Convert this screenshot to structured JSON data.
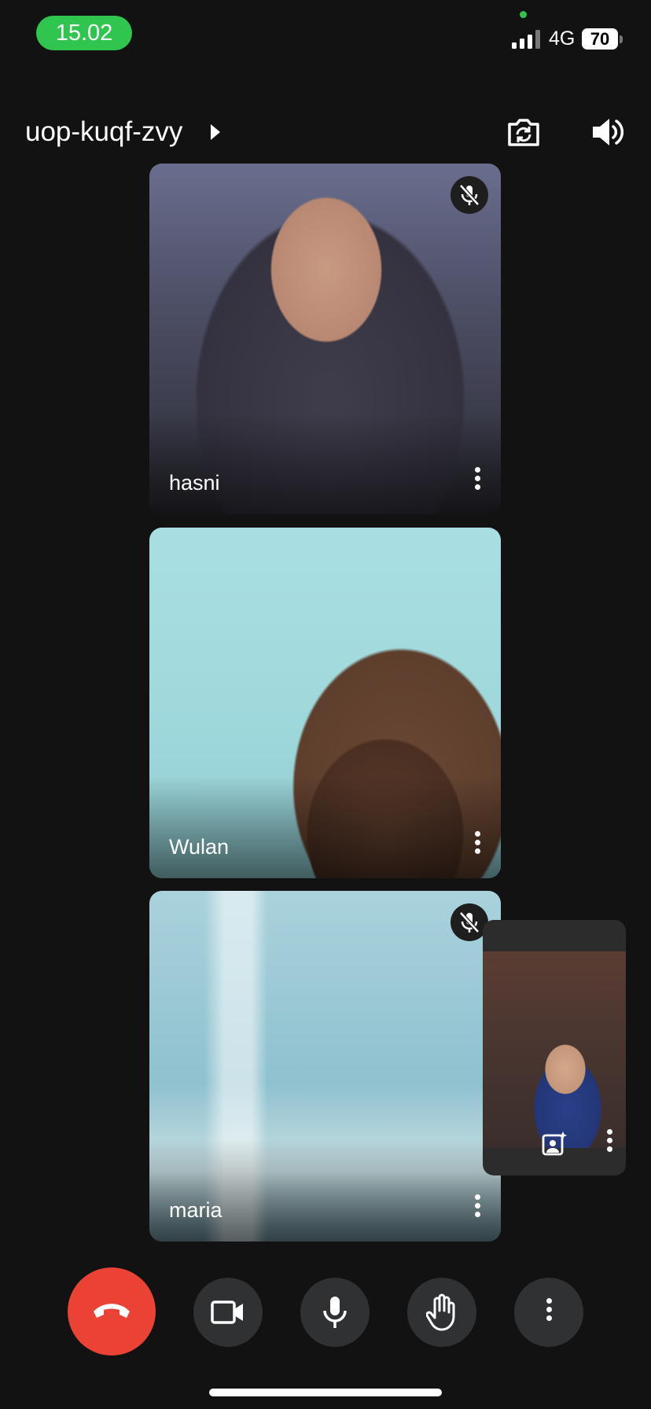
{
  "status_bar": {
    "time": "15.02",
    "network": "4G",
    "battery": "70"
  },
  "header": {
    "meeting_code": "uop-kuqf-zvy"
  },
  "participants": [
    {
      "name": "hasni",
      "muted": true
    },
    {
      "name": "Wulan",
      "muted": false
    },
    {
      "name": "maria",
      "muted": true
    }
  ],
  "controls": {
    "end_call": "end-call",
    "camera": "video-camera",
    "microphone": "microphone",
    "raise_hand": "raise-hand",
    "more": "more-options"
  },
  "colors": {
    "end_call": "#ea4335",
    "time_pill": "#2fc54e",
    "control_bg": "#2f3133",
    "background": "#121212"
  }
}
